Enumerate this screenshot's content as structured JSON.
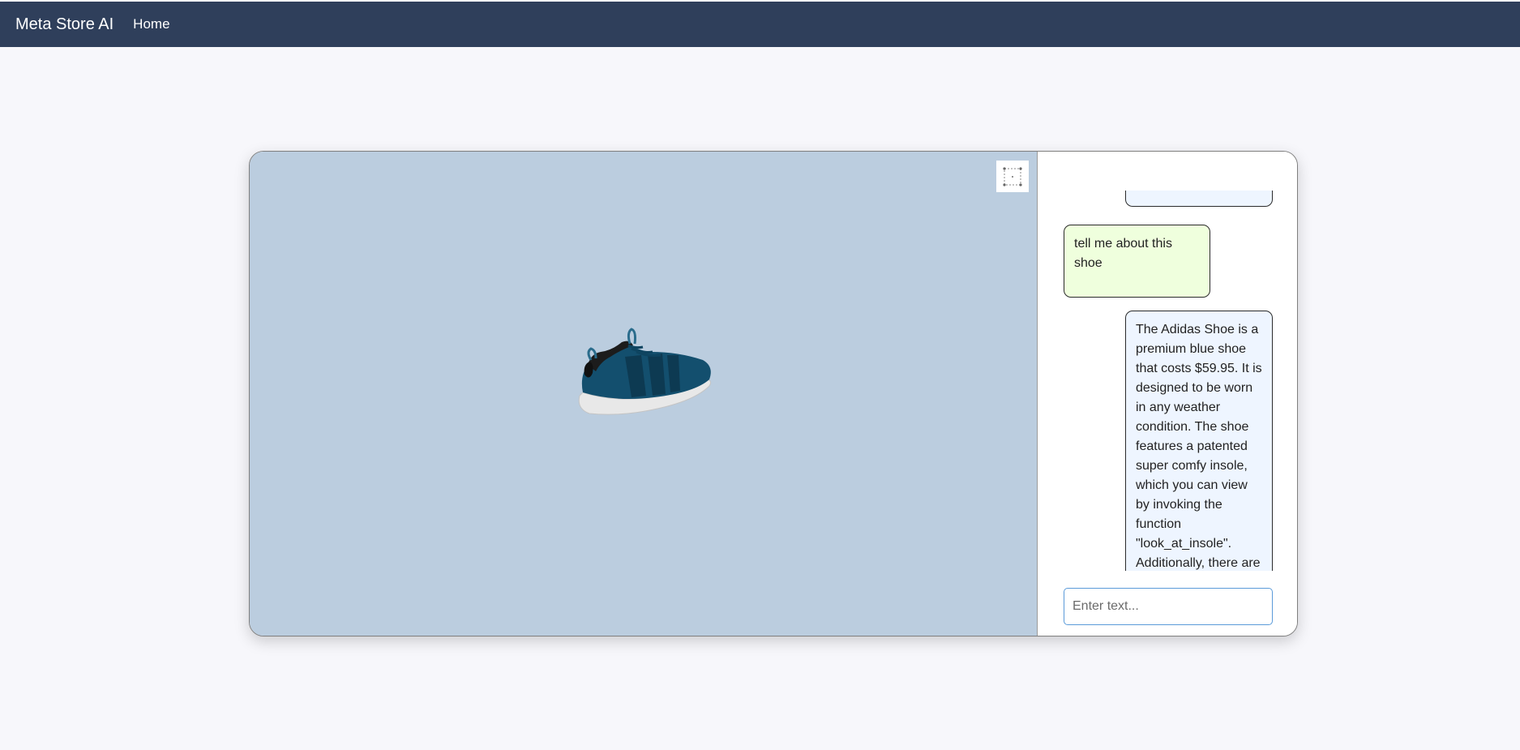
{
  "navbar": {
    "brand": "Meta Store AI",
    "links": [
      {
        "label": "Home"
      }
    ]
  },
  "viewer": {
    "background": "#bbcddf",
    "product_icon": "sneaker-icon",
    "fullscreen_icon": "fullscreen-icon"
  },
  "chat": {
    "messages": [
      {
        "role": "assistant",
        "text": ""
      },
      {
        "role": "user",
        "text": "tell me about this shoe"
      },
      {
        "role": "assistant",
        "text": "The Adidas Shoe is a premium blue shoe that costs $59.95. It is designed to be worn in any weather condition. The shoe features a patented super comfy insole, which you can view by invoking the function \"look_at_insole\". Additionally, there are an infinite"
      }
    ],
    "input": {
      "placeholder": "Enter text...",
      "value": ""
    }
  },
  "colors": {
    "navbar": "#2f3f5b",
    "user_bubble": "#efffdd",
    "assistant_bubble": "#eef5ff",
    "input_border": "#5b9bd9"
  }
}
